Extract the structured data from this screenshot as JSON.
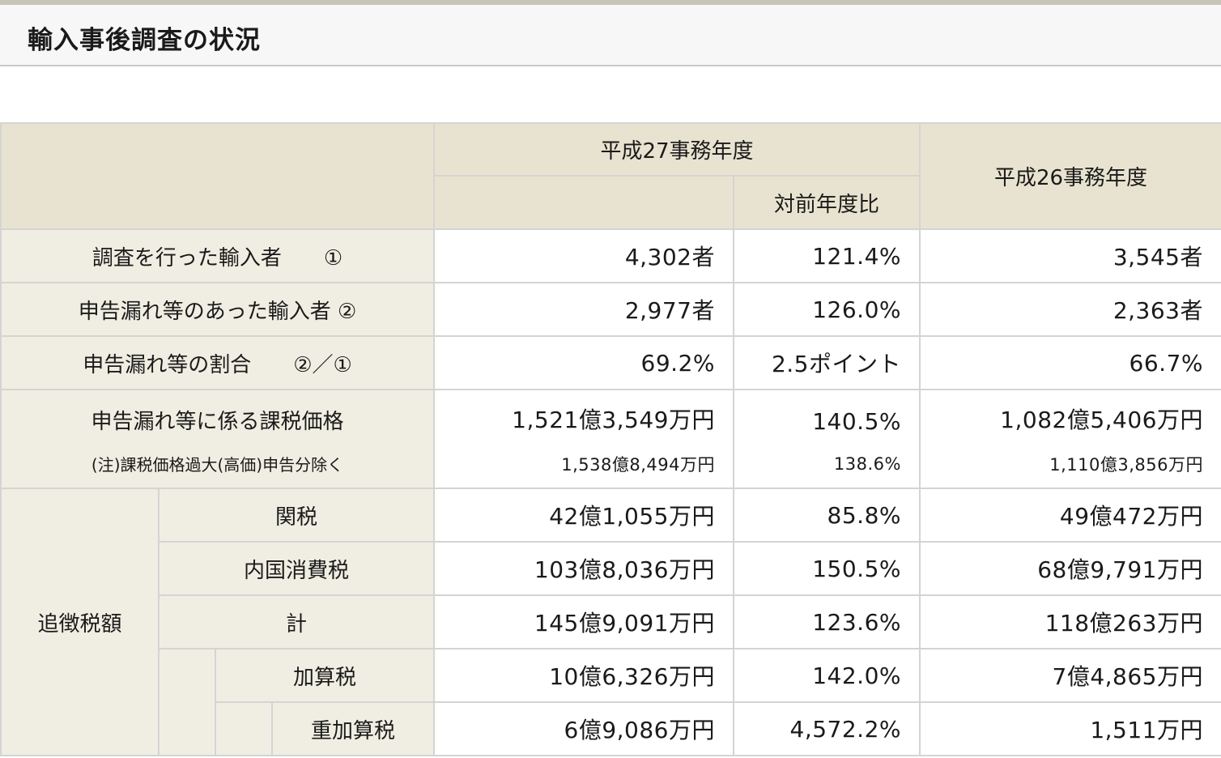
{
  "page_title": "輸入事後調査の状況",
  "table": {
    "col_h27": "平成27事務年度",
    "col_ratio": "対前年度比",
    "col_h26": "平成26事務年度",
    "rows": [
      {
        "label": "調査を行った輸入者　　①",
        "h27": "4,302者",
        "ratio": "121.4%",
        "h26": "3,545者"
      },
      {
        "label": "申告漏れ等のあった輸入者 ②",
        "h27": "2,977者",
        "ratio": "126.0%",
        "h26": "2,363者"
      },
      {
        "label": "申告漏れ等の割合　　②／①",
        "h27": "69.2%",
        "ratio": "2.5ポイント",
        "h26": "66.7%"
      },
      {
        "label": "申告漏れ等に係る課税価格",
        "h27": "1,521億3,549万円",
        "ratio": "140.5%",
        "h26": "1,082億5,406万円"
      },
      {
        "label": "(注)課税価格過大(高価)申告分除く",
        "h27": "1,538億8,494万円",
        "ratio": "138.6%",
        "h26": "1,110億3,856万円"
      }
    ],
    "tax_group_label": "追徴税額",
    "tax_rows": [
      {
        "label": "関税",
        "h27": "42億1,055万円",
        "ratio": "85.8%",
        "h26": "49億472万円"
      },
      {
        "label": "内国消費税",
        "h27": "103億8,036万円",
        "ratio": "150.5%",
        "h26": "68億9,791万円"
      },
      {
        "label": "計",
        "h27": "145億9,091万円",
        "ratio": "123.6%",
        "h26": "118億263万円"
      },
      {
        "label": "加算税",
        "h27": "10億6,326万円",
        "ratio": "142.0%",
        "h26": "7億4,865万円"
      },
      {
        "label": "重加算税",
        "h27": "6億9,086万円",
        "ratio": "4,572.2%",
        "h26": "1,511万円"
      }
    ]
  }
}
